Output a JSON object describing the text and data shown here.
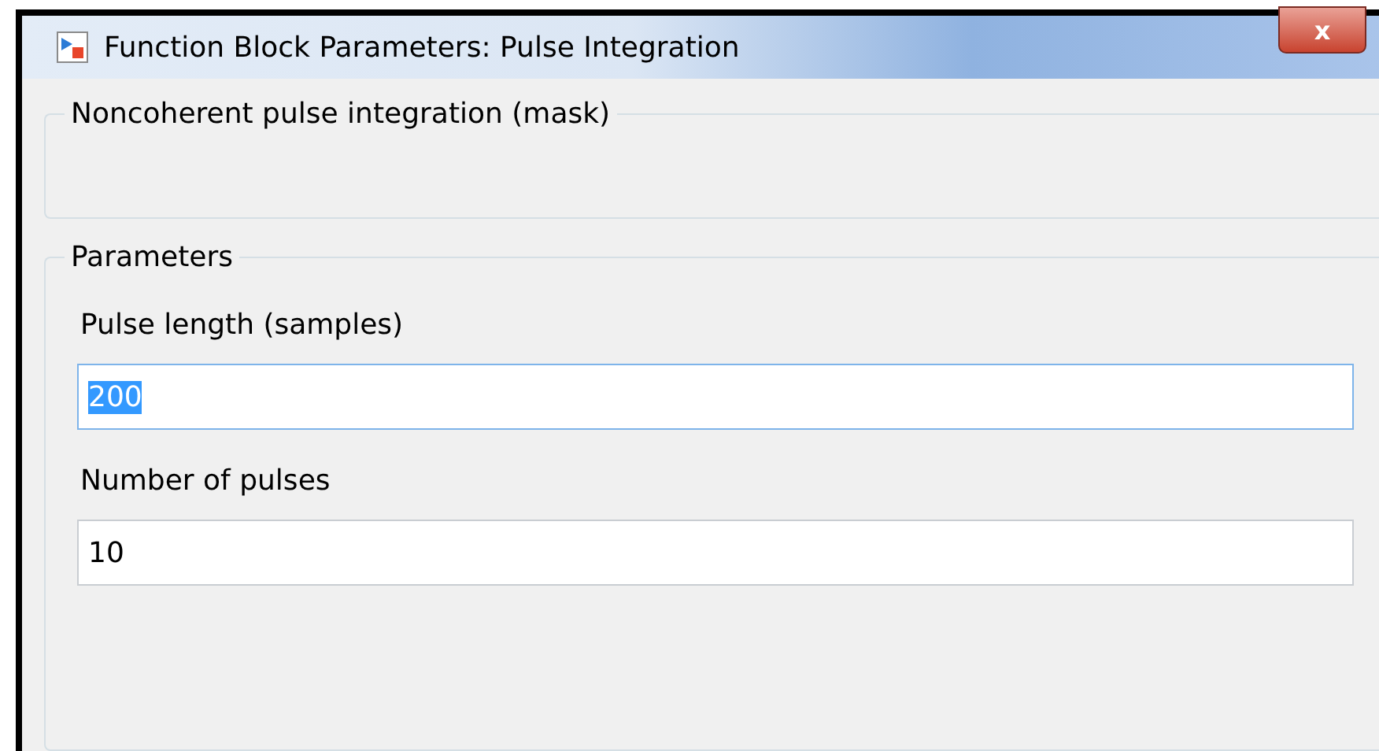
{
  "window": {
    "title": "Function Block Parameters: Pulse Integration",
    "close_label": "x"
  },
  "description_group": {
    "title": "Noncoherent pulse integration (mask)"
  },
  "parameters_group": {
    "title": "Parameters",
    "fields": [
      {
        "label": "Pulse length (samples)",
        "value": "200",
        "selected": true
      },
      {
        "label": "Number of pulses",
        "value": "10",
        "selected": false
      }
    ]
  }
}
